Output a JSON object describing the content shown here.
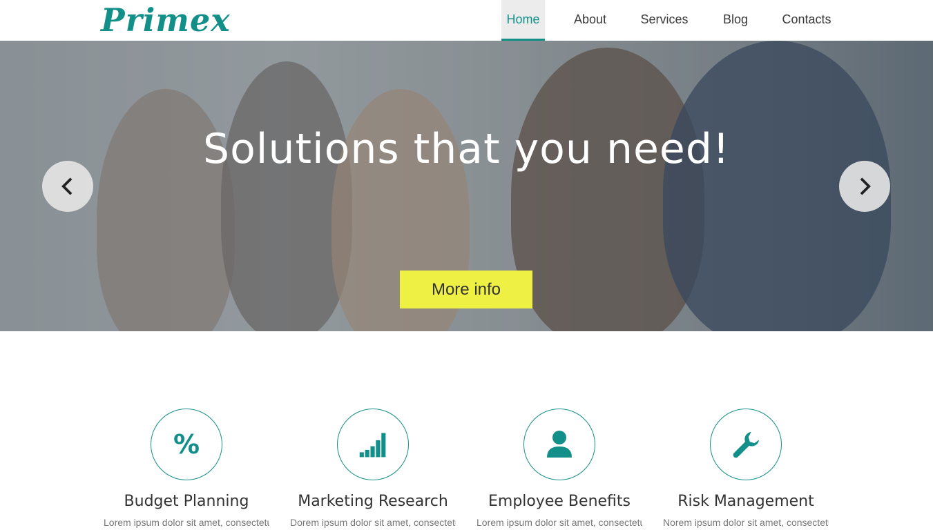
{
  "brand": {
    "name": "Primex",
    "color": "#138f89"
  },
  "nav": {
    "items": [
      {
        "label": "Home",
        "active": true
      },
      {
        "label": "About"
      },
      {
        "label": "Services"
      },
      {
        "label": "Blog"
      },
      {
        "label": "Contacts"
      }
    ]
  },
  "hero": {
    "title": "Solutions that you need!",
    "cta_label": "More info",
    "cta_color": "#eef043",
    "prev_icon": "chevron-left-icon",
    "next_icon": "chevron-right-icon"
  },
  "features": [
    {
      "title": "Budget Planning",
      "icon": "percent-icon",
      "glyph": "%",
      "text": "Lorem ipsum dolor sit amet, consectetur"
    },
    {
      "title": "Marketing Research",
      "icon": "bar-chart-icon",
      "text": "Dorem ipsum dolor sit amet, consectetur"
    },
    {
      "title": "Employee Benefits",
      "icon": "user-icon",
      "text": "Lorem ipsum dolor sit amet, consectetur"
    },
    {
      "title": "Risk Management",
      "icon": "wrench-icon",
      "text": "Norem ipsum dolor sit amet, consectetur"
    }
  ]
}
